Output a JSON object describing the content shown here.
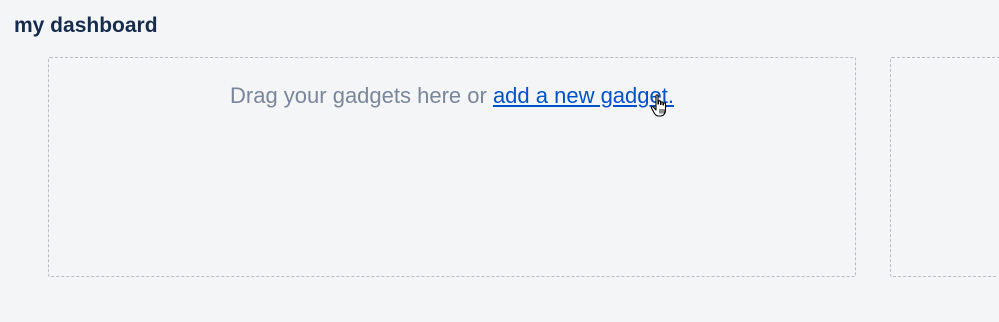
{
  "header": {
    "title": "my dashboard"
  },
  "column_primary": {
    "drop_message": "Drag your gadgets here or ",
    "add_gadget_link": "add a new gadget."
  },
  "icons": {
    "cursor": "hand-pointer-icon"
  },
  "colors": {
    "background": "#f4f5f7",
    "title": "#172b4d",
    "muted_text": "#7a869a",
    "link": "#0052cc",
    "dashed_border": "#b8bcc4"
  }
}
